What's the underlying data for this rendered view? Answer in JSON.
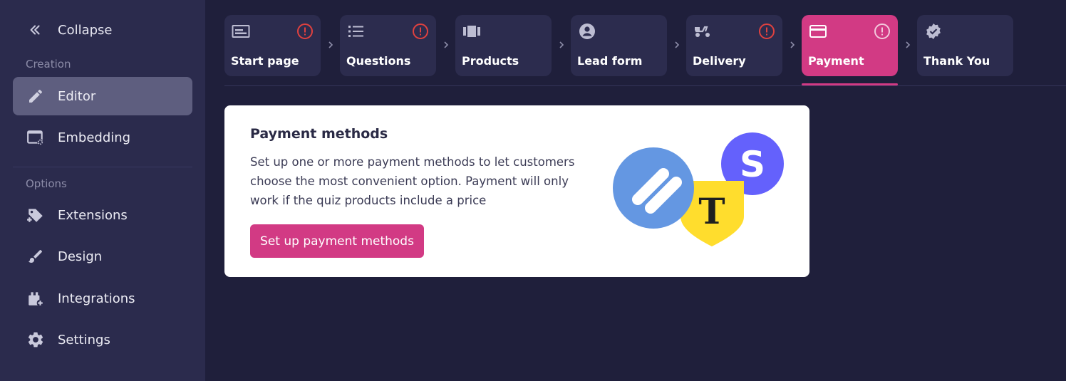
{
  "sidebar": {
    "collapse_label": "Collapse",
    "section_creation": "Creation",
    "section_options": "Options",
    "items": [
      {
        "label": "Editor",
        "icon": "pencil-icon",
        "active": true
      },
      {
        "label": "Embedding",
        "icon": "embed-icon",
        "active": false
      },
      {
        "label": "Extensions",
        "icon": "puzzle-icon",
        "active": false
      },
      {
        "label": "Design",
        "icon": "brush-icon",
        "active": false
      },
      {
        "label": "Integrations",
        "icon": "plugin-icon",
        "active": false
      },
      {
        "label": "Settings",
        "icon": "gear-icon",
        "active": false
      }
    ]
  },
  "steps": [
    {
      "label": "Start page",
      "icon": "start-page-icon",
      "warning": true
    },
    {
      "label": "Questions",
      "icon": "list-icon",
      "warning": true
    },
    {
      "label": "Products",
      "icon": "products-icon",
      "warning": false
    },
    {
      "label": "Lead form",
      "icon": "user-icon",
      "warning": false
    },
    {
      "label": "Delivery",
      "icon": "scooter-icon",
      "warning": true
    },
    {
      "label": "Payment",
      "icon": "card-icon",
      "warning": true,
      "active": true
    },
    {
      "label": "Thank You",
      "icon": "verified-icon",
      "warning": false
    }
  ],
  "card": {
    "title": "Payment methods",
    "description": "Set up one or more payment methods to let customers choose the most convenient option. Payment will only work if the quiz products include a price",
    "button_label": "Set up payment methods",
    "logos": [
      "yookassa-logo",
      "tinkoff-logo",
      "stripe-logo"
    ]
  },
  "colors": {
    "background": "#1f1f3b",
    "sidebar": "#2b2b4d",
    "accent": "#d23a84",
    "warning": "#e0413f"
  }
}
